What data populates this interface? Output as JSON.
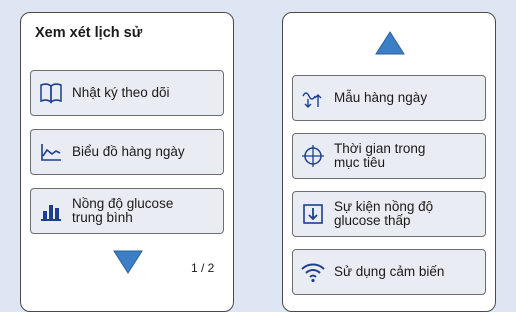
{
  "left_screen": {
    "title": "Xem xét lịch sử",
    "items": [
      {
        "label": "Nhật ký theo dõi",
        "icon": "book-icon"
      },
      {
        "label": "Biểu đồ hàng ngày",
        "icon": "line-graph-icon"
      },
      {
        "label": "Nồng độ glucose\ntrung bình",
        "icon": "bar-chart-icon"
      }
    ],
    "page_indicator": "1 / 2",
    "nav_icon": "down-arrow-icon"
  },
  "right_screen": {
    "nav_icon": "up-arrow-icon",
    "items": [
      {
        "label": "Mẫu hàng ngày",
        "icon": "daily-pattern-icon"
      },
      {
        "label": "Thời gian trong\nmục tiêu",
        "icon": "target-icon"
      },
      {
        "label": "Sự kiện nồng độ\nglucose thấp",
        "icon": "low-glucose-icon"
      },
      {
        "label": "Sử dụng cảm biến",
        "icon": "sensor-signal-icon"
      }
    ]
  },
  "colors": {
    "accent": "#3d7fc7",
    "background": "#dde6f2",
    "button": "#e9ecf2",
    "icon": "#1d3f8f"
  }
}
